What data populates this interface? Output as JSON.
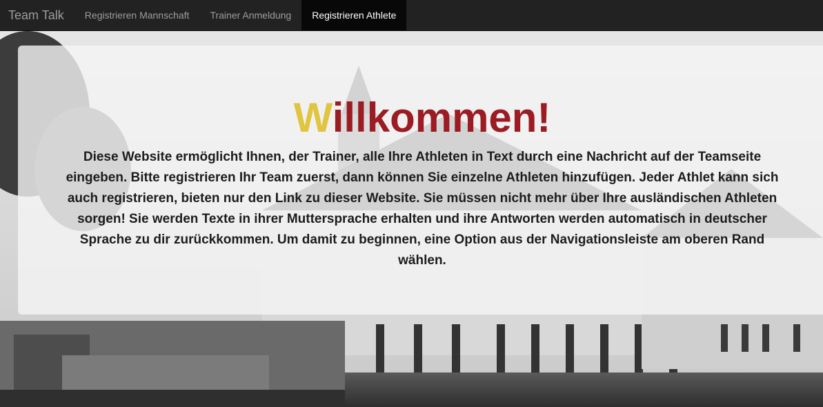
{
  "navbar": {
    "brand": "Team Talk",
    "items": [
      {
        "label": "Registrieren Mannschaft",
        "active": false
      },
      {
        "label": "Trainer Anmeldung",
        "active": false
      },
      {
        "label": "Registrieren Athlete",
        "active": true
      }
    ]
  },
  "hero": {
    "title_first_letter": "W",
    "title_rest": "illkommen!",
    "intro": "Diese Website ermöglicht Ihnen, der Trainer, alle Ihre Athleten in Text durch eine Nachricht auf der Teamseite eingeben. Bitte registrieren Ihr Team zuerst, dann können Sie einzelne Athleten hinzufügen. Jeder Athlet kann sich auch registrieren, bieten nur den Link zu dieser Website. Sie müssen nicht mehr über Ihre ausländischen Athleten sorgen! Sie werden Texte in ihrer Muttersprache erhalten und ihre Antworten werden automatisch in deutscher Sprache zu dir zurückkommen. Um damit zu beginnen, eine Option aus der Navigationsleiste am oberen Rand wählen."
  },
  "colors": {
    "navbar_bg": "#222222",
    "title_accent": "#e0c541",
    "title_main": "#9b1c22"
  }
}
